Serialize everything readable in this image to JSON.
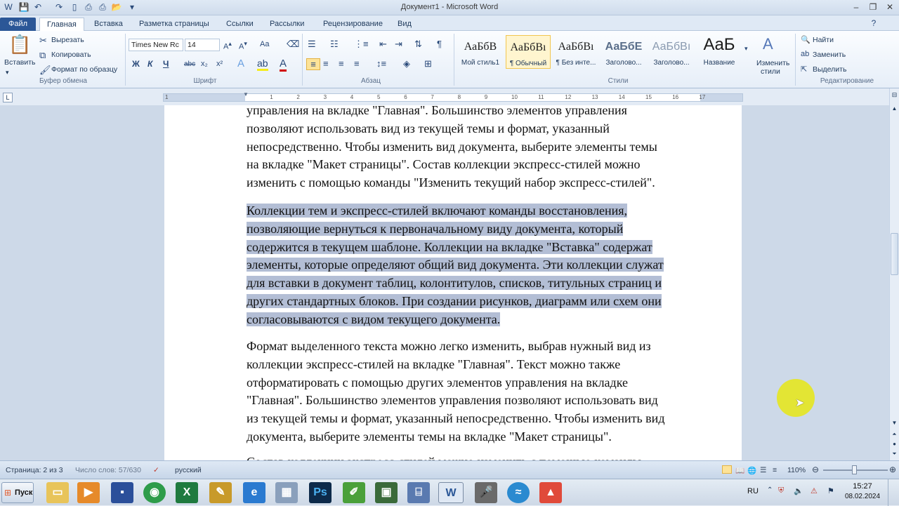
{
  "window": {
    "title": "Документ1 - Microsoft Word"
  },
  "tabs": [
    {
      "label": "Файл"
    },
    {
      "label": "Главная"
    },
    {
      "label": "Вставка"
    },
    {
      "label": "Разметка страницы"
    },
    {
      "label": "Ссылки"
    },
    {
      "label": "Рассылки"
    },
    {
      "label": "Рецензирование"
    },
    {
      "label": "Вид"
    }
  ],
  "ribbon": {
    "clipboard": {
      "paste": "Вставить",
      "cut": "Вырезать",
      "copy": "Копировать",
      "format_painter": "Формат по образцу",
      "label": "Буфер обмена"
    },
    "font": {
      "name": "Times New Rc",
      "size": "14",
      "label": "Шрифт",
      "bold": "Ж",
      "italic": "К",
      "underline": "Ч",
      "strike": "abc",
      "sub": "x₂",
      "sup": "x²",
      "case": "Aa"
    },
    "paragraph": {
      "label": "Абзац"
    },
    "styles": {
      "label": "Стили",
      "items": [
        {
          "sample": "АаБбВ",
          "name": "Мой стиль1"
        },
        {
          "sample": "АаБбВı",
          "name": "¶ Обычный"
        },
        {
          "sample": "АаБбВı",
          "name": "¶ Без инте..."
        },
        {
          "sample": "АаБбЕ",
          "name": "Заголово..."
        },
        {
          "sample": "АаБбВı",
          "name": "Заголово..."
        },
        {
          "sample": "AaБ",
          "name": "Название"
        }
      ],
      "change": "Изменить",
      "change2": "стили"
    },
    "editing": {
      "label": "Редактирование",
      "find": "Найти",
      "replace": "Заменить",
      "select": "Выделить"
    }
  },
  "ruler_numbers": [
    "1",
    "1",
    "2",
    "3",
    "4",
    "5",
    "6",
    "7",
    "8",
    "9",
    "10",
    "11",
    "12",
    "13",
    "14",
    "15",
    "16",
    "17"
  ],
  "document": {
    "p1": [
      "управления на вкладке \"Главная\". Большинство элементов управления",
      "позволяют использовать вид из текущей темы и формат, указанный",
      "непосредственно. Чтобы изменить вид документа, выберите элементы темы",
      "на вкладке \"Макет страницы\". Состав коллекции экспресс-стилей можно",
      "изменить с помощью команды \"Изменить текущий набор экспресс-стилей\"."
    ],
    "p2": [
      "Коллекции тем и экспресс-стилей включают команды восстановления,",
      "позволяющие вернуться к первоначальному виду документа, который",
      "содержится в текущем шаблоне. Коллекции на вкладке \"Вставка\" содержат",
      "элементы, которые определяют общий вид документа. Эти коллекции служат",
      "для вставки в документ таблиц, колонтитулов, списков, титульных страниц и",
      "других стандартных блоков. При создании рисунков, диаграмм или схем они",
      "согласовываются с видом текущего документа."
    ],
    "p3": [
      "Формат выделенного текста можно легко изменить, выбрав нужный вид из",
      "коллекции экспресс-стилей на вкладке \"Главная\". Текст можно также",
      "отформатировать с помощью других элементов управления на вкладке",
      "\"Главная\". Большинство элементов управления позволяют использовать вид",
      "из текущей темы и формат, указанный непосредственно. Чтобы изменить вид",
      "документа, выберите элементы темы на вкладке \"Макет страницы\"."
    ],
    "p4": "Состав коллекции экспресс-стилей можно изменить с помощью команды"
  },
  "status": {
    "page": "Страница: 2 из 3",
    "words": "Число слов: 57/630",
    "lang": "русский",
    "zoom": "110%"
  },
  "taskbar": {
    "start": "Пуск",
    "lang": "RU",
    "time": "15:27",
    "date": "08.02.2024"
  }
}
